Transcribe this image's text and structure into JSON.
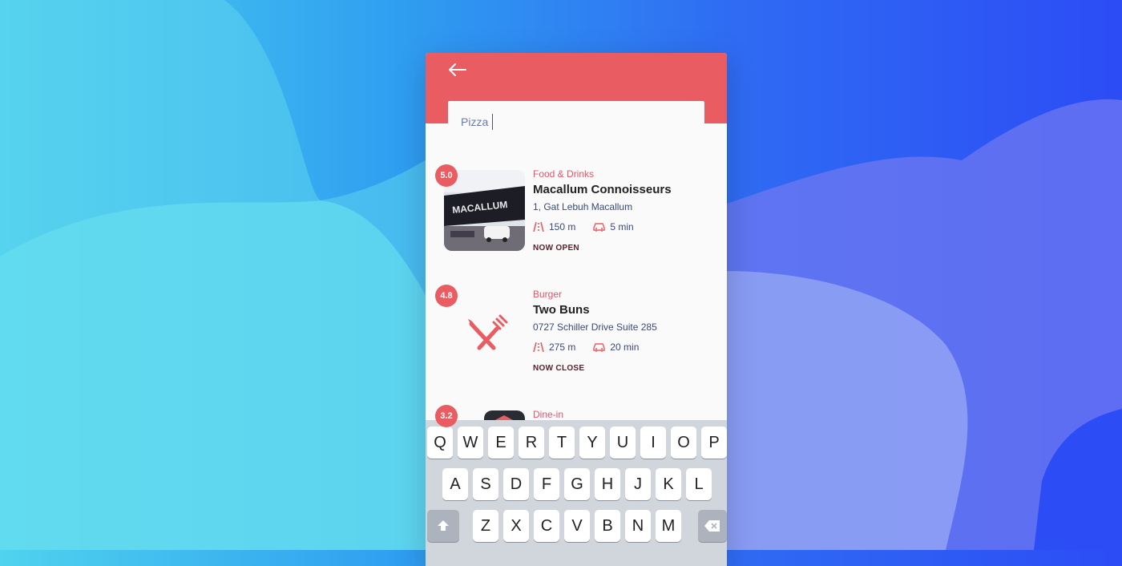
{
  "colors": {
    "accent": "#e85c62",
    "category": "#e0566a",
    "status": "#5a1e2a",
    "text_secondary": "#3a4a7a"
  },
  "header": {
    "back_icon": "back-arrow-icon"
  },
  "search": {
    "value": "Pizza"
  },
  "results": [
    {
      "rating": "5.0",
      "category": "Food & Drinks",
      "name": "Macallum Connoisseurs",
      "address": "1, Gat Lebuh Macallum",
      "distance": "150 m",
      "drive_time": "5 min",
      "status": "NOW OPEN",
      "thumb": "photo",
      "thumb_text": "MACALLUM"
    },
    {
      "rating": "4.8",
      "category": "Burger",
      "name": "Two Buns",
      "address": "0727 Schiller Drive Suite 285",
      "distance": "275 m",
      "drive_time": "20 min",
      "status": "NOW CLOSE",
      "thumb": "fork-knife-icon"
    },
    {
      "rating": "3.2",
      "category": "Dine-in",
      "name": "",
      "address": "",
      "distance": "",
      "drive_time": "",
      "status": "",
      "thumb": "photo"
    }
  ],
  "keyboard": {
    "row1": [
      "Q",
      "W",
      "E",
      "R",
      "T",
      "Y",
      "U",
      "I",
      "O",
      "P"
    ],
    "row2": [
      "A",
      "S",
      "D",
      "F",
      "G",
      "H",
      "J",
      "K",
      "L"
    ],
    "row3": [
      "Z",
      "X",
      "C",
      "V",
      "B",
      "N",
      "M"
    ],
    "shift_icon": "shift-icon",
    "delete_icon": "delete-icon"
  }
}
